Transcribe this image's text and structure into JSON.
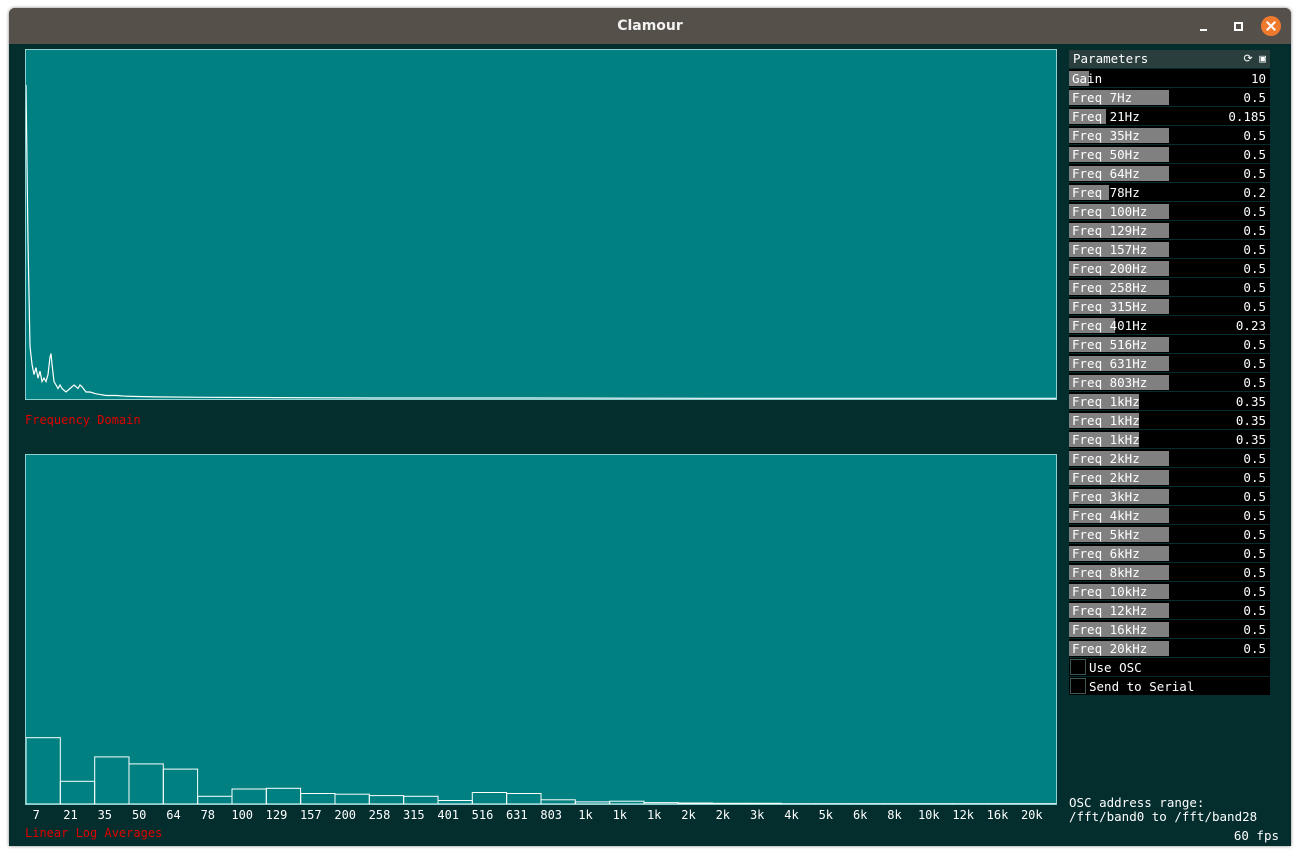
{
  "window": {
    "title": "Clamour"
  },
  "frequency_domain": {
    "caption": "Frequency Domain",
    "spectrum_points": [
      [
        0,
        0.9
      ],
      [
        2,
        0.45
      ],
      [
        4,
        0.15
      ],
      [
        6,
        0.1
      ],
      [
        8,
        0.07
      ],
      [
        10,
        0.09
      ],
      [
        12,
        0.06
      ],
      [
        14,
        0.08
      ],
      [
        16,
        0.05
      ],
      [
        18,
        0.06
      ],
      [
        20,
        0.05
      ],
      [
        22,
        0.07
      ],
      [
        24,
        0.12
      ],
      [
        25,
        0.13
      ],
      [
        26,
        0.1
      ],
      [
        28,
        0.05
      ],
      [
        30,
        0.04
      ],
      [
        32,
        0.03
      ],
      [
        34,
        0.04
      ],
      [
        36,
        0.03
      ],
      [
        40,
        0.02
      ],
      [
        44,
        0.03
      ],
      [
        48,
        0.04
      ],
      [
        52,
        0.03
      ],
      [
        54,
        0.04
      ],
      [
        56,
        0.035
      ],
      [
        60,
        0.02
      ],
      [
        64,
        0.02
      ],
      [
        70,
        0.015
      ],
      [
        80,
        0.01
      ],
      [
        90,
        0.01
      ],
      [
        100,
        0.008
      ],
      [
        130,
        0.006
      ],
      [
        180,
        0.005
      ],
      [
        250,
        0.004
      ],
      [
        350,
        0.003
      ],
      [
        500,
        0.003
      ],
      [
        700,
        0.002
      ],
      [
        1030,
        0.002
      ]
    ]
  },
  "linear_log_averages": {
    "caption": "Linear Log Averages",
    "band_labels": [
      "7",
      "21",
      "35",
      "50",
      "64",
      "78",
      "100",
      "129",
      "157",
      "200",
      "258",
      "315",
      "401",
      "516",
      "631",
      "803",
      "1k",
      "1k",
      "1k",
      "2k",
      "2k",
      "3k",
      "4k",
      "5k",
      "6k",
      "8k",
      "10k",
      "12k",
      "16k",
      "20k"
    ],
    "band_values": [
      0.19,
      0.065,
      0.135,
      0.115,
      0.1,
      0.022,
      0.043,
      0.045,
      0.03,
      0.028,
      0.024,
      0.022,
      0.01,
      0.033,
      0.03,
      0.012,
      0.006,
      0.008,
      0.004,
      0.003,
      0.002,
      0.002,
      0.001,
      0.001,
      0.001,
      0.001,
      0.001,
      0.001,
      0.001,
      0.001
    ]
  },
  "parameters": {
    "header": "Parameters",
    "header_icons": [
      "refresh-icon",
      "save-icon"
    ],
    "rows": [
      {
        "label": "Gain",
        "value": "10",
        "fill": 0.1
      },
      {
        "label": "Freq 7Hz",
        "value": "0.5",
        "fill": 0.5
      },
      {
        "label": "Freq 21Hz",
        "value": "0.185",
        "fill": 0.185
      },
      {
        "label": "Freq 35Hz",
        "value": "0.5",
        "fill": 0.5
      },
      {
        "label": "Freq 50Hz",
        "value": "0.5",
        "fill": 0.5
      },
      {
        "label": "Freq 64Hz",
        "value": "0.5",
        "fill": 0.5
      },
      {
        "label": "Freq 78Hz",
        "value": "0.2",
        "fill": 0.2
      },
      {
        "label": "Freq 100Hz",
        "value": "0.5",
        "fill": 0.5
      },
      {
        "label": "Freq 129Hz",
        "value": "0.5",
        "fill": 0.5
      },
      {
        "label": "Freq 157Hz",
        "value": "0.5",
        "fill": 0.5
      },
      {
        "label": "Freq 200Hz",
        "value": "0.5",
        "fill": 0.5
      },
      {
        "label": "Freq 258Hz",
        "value": "0.5",
        "fill": 0.5
      },
      {
        "label": "Freq 315Hz",
        "value": "0.5",
        "fill": 0.5
      },
      {
        "label": "Freq 401Hz",
        "value": "0.23",
        "fill": 0.23
      },
      {
        "label": "Freq 516Hz",
        "value": "0.5",
        "fill": 0.5
      },
      {
        "label": "Freq 631Hz",
        "value": "0.5",
        "fill": 0.5
      },
      {
        "label": "Freq 803Hz",
        "value": "0.5",
        "fill": 0.5
      },
      {
        "label": "Freq 1kHz",
        "value": "0.35",
        "fill": 0.35
      },
      {
        "label": "Freq 1kHz",
        "value": "0.35",
        "fill": 0.35
      },
      {
        "label": "Freq 1kHz",
        "value": "0.35",
        "fill": 0.35
      },
      {
        "label": "Freq 2kHz",
        "value": "0.5",
        "fill": 0.5
      },
      {
        "label": "Freq 2kHz",
        "value": "0.5",
        "fill": 0.5
      },
      {
        "label": "Freq 3kHz",
        "value": "0.5",
        "fill": 0.5
      },
      {
        "label": "Freq 4kHz",
        "value": "0.5",
        "fill": 0.5
      },
      {
        "label": "Freq 5kHz",
        "value": "0.5",
        "fill": 0.5
      },
      {
        "label": "Freq 6kHz",
        "value": "0.5",
        "fill": 0.5
      },
      {
        "label": "Freq 8kHz",
        "value": "0.5",
        "fill": 0.5
      },
      {
        "label": "Freq 10kHz",
        "value": "0.5",
        "fill": 0.5
      },
      {
        "label": "Freq 12kHz",
        "value": "0.5",
        "fill": 0.5
      },
      {
        "label": "Freq 16kHz",
        "value": "0.5",
        "fill": 0.5
      },
      {
        "label": "Freq 20kHz",
        "value": "0.5",
        "fill": 0.5
      }
    ],
    "toggles": [
      {
        "label": "Use OSC",
        "checked": false
      },
      {
        "label": "Send to Serial",
        "checked": false
      }
    ]
  },
  "osc_info": {
    "line1": "OSC address range:",
    "line2": "/fft/band0 to /fft/band28"
  },
  "fps": "60 fps",
  "colors": {
    "plot_bg": "#008080",
    "caption": "#e00000",
    "slider_fill": "#808080",
    "app_bg": "#042d2d"
  }
}
